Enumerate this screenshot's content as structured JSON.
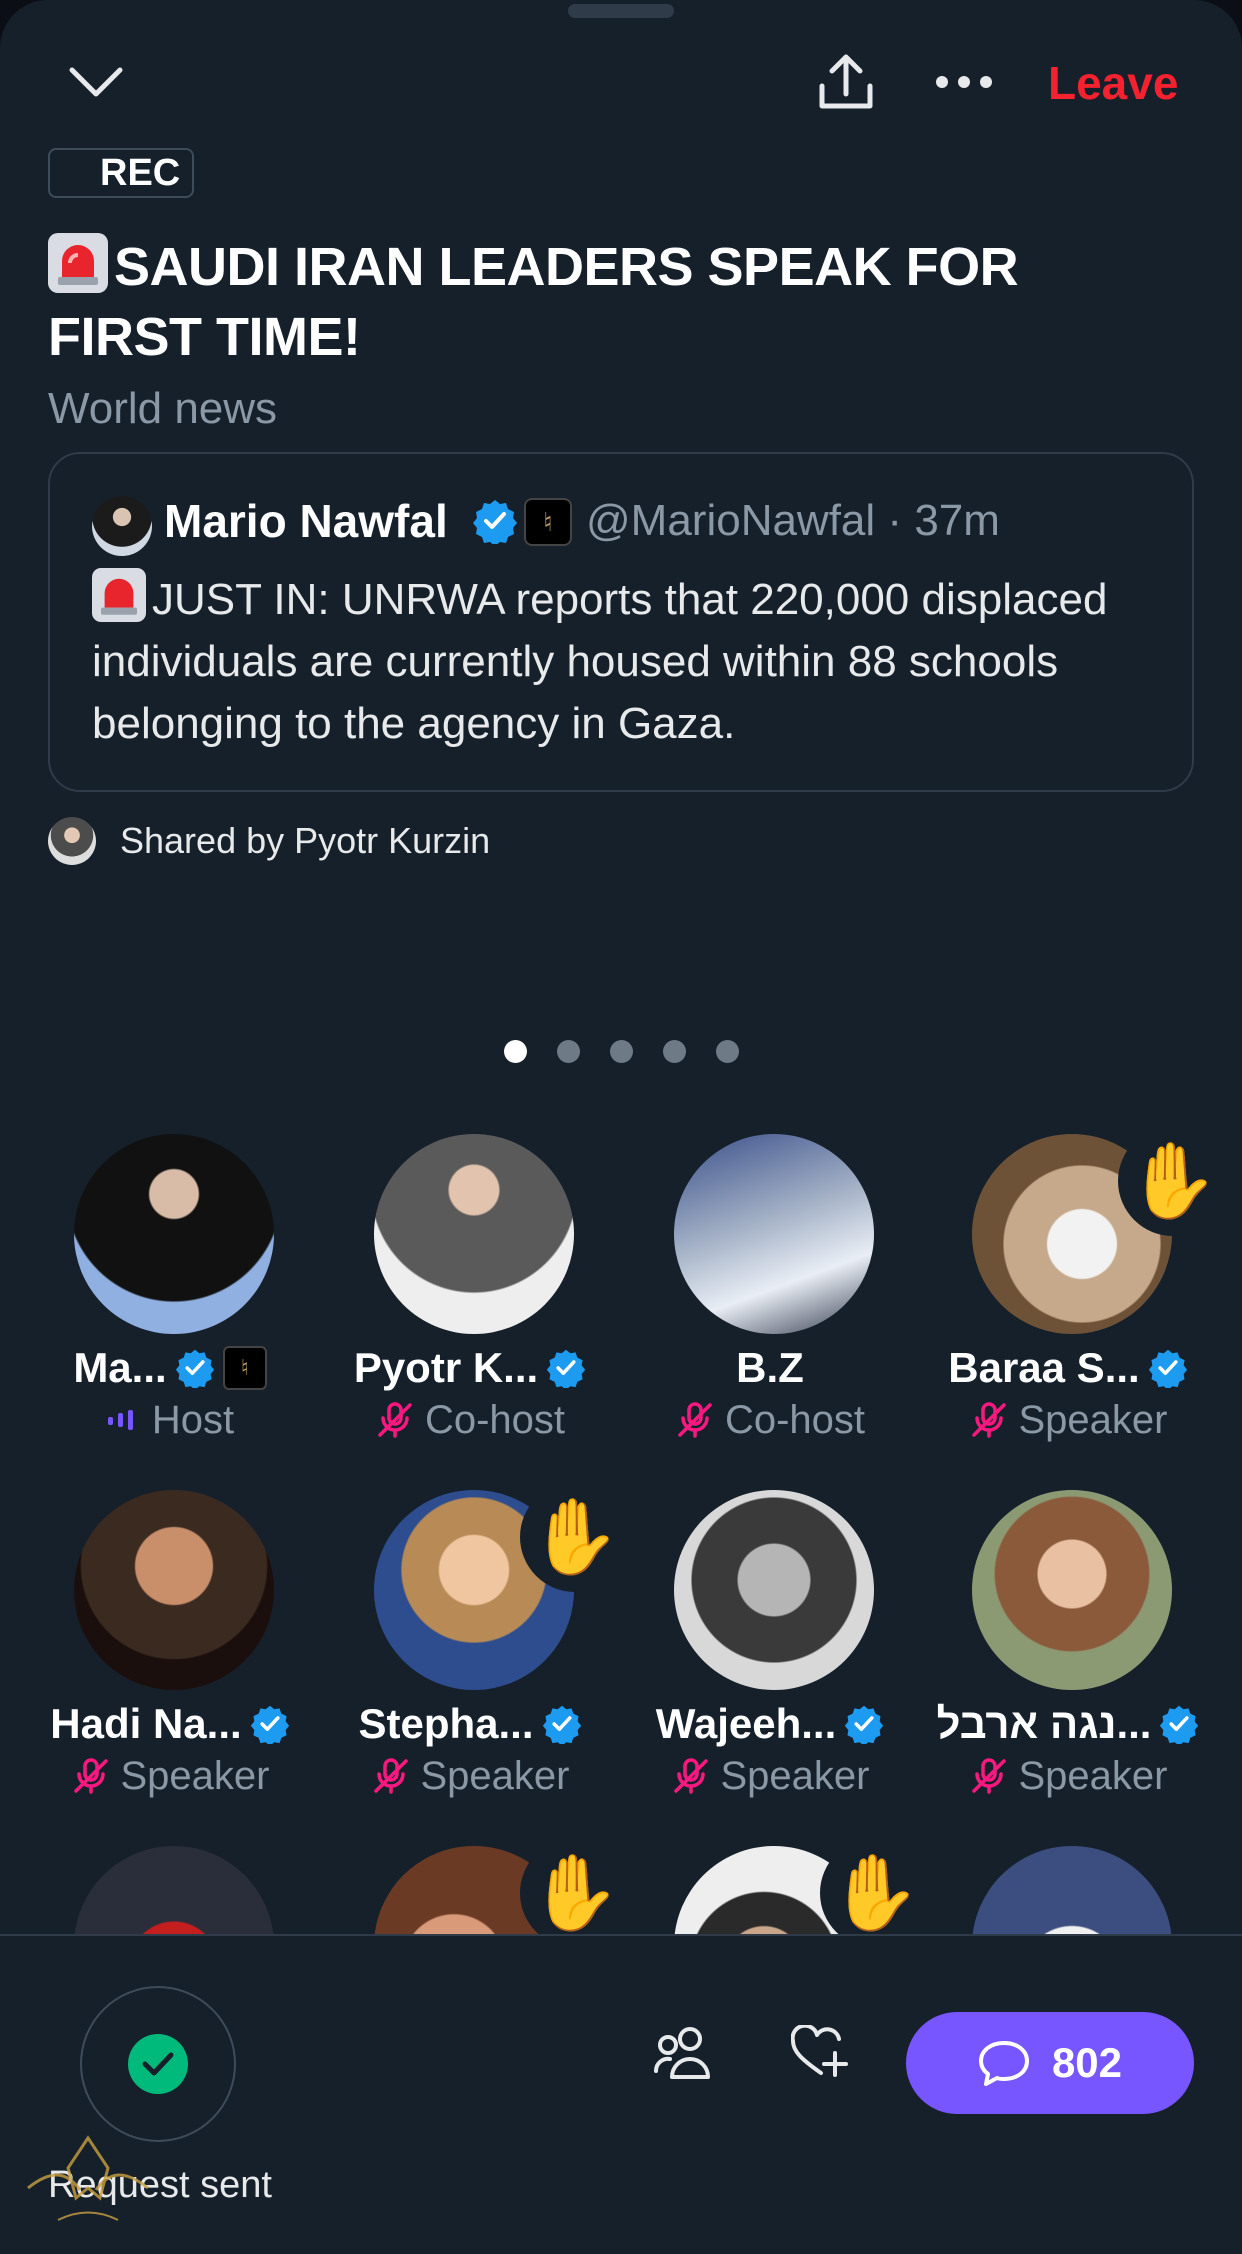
{
  "header": {
    "leave_label": "Leave",
    "rec_label": "REC",
    "title": "SAUDI IRAN LEADERS SPEAK FOR FIRST TIME!",
    "topic": "World news"
  },
  "pinned_tweet": {
    "author_name": "Mario Nawfal",
    "handle": "@MarioNawfal",
    "separator": "·",
    "age": "37m",
    "text": "JUST IN: UNRWA reports that 220,000 displaced individuals are currently housed within 88 schools belonging to the agency in Gaza."
  },
  "shared_by": "Shared by Pyotr Kurzin",
  "carousel": {
    "page_count": 5,
    "active_index": 0
  },
  "participants": [
    {
      "name": "Ma...",
      "role": "Host",
      "verified": true,
      "affiliate": true,
      "hand": false,
      "muted": false
    },
    {
      "name": "Pyotr K...",
      "role": "Co-host",
      "verified": true,
      "affiliate": false,
      "hand": false,
      "muted": true
    },
    {
      "name": "B.Z",
      "role": "Co-host",
      "verified": false,
      "affiliate": false,
      "hand": false,
      "muted": true
    },
    {
      "name": "Baraa S...",
      "role": "Speaker",
      "verified": true,
      "affiliate": false,
      "hand": true,
      "muted": true
    },
    {
      "name": "Hadi Na...",
      "role": "Speaker",
      "verified": true,
      "affiliate": false,
      "hand": false,
      "muted": true
    },
    {
      "name": "Stepha...",
      "role": "Speaker",
      "verified": true,
      "affiliate": false,
      "hand": true,
      "muted": true
    },
    {
      "name": "Wajeeh...",
      "role": "Speaker",
      "verified": true,
      "affiliate": false,
      "hand": false,
      "muted": true
    },
    {
      "name": "נגה ארבל...",
      "role": "Speaker",
      "verified": true,
      "affiliate": false,
      "hand": false,
      "muted": true
    },
    {
      "name": "",
      "role": "",
      "verified": false,
      "affiliate": false,
      "hand": false,
      "muted": false
    },
    {
      "name": "",
      "role": "",
      "verified": false,
      "affiliate": false,
      "hand": true,
      "muted": false
    },
    {
      "name": "",
      "role": "",
      "verified": false,
      "affiliate": false,
      "hand": true,
      "muted": false
    },
    {
      "name": "",
      "role": "",
      "verified": false,
      "affiliate": false,
      "hand": false,
      "muted": false
    }
  ],
  "footer": {
    "request_label": "Request sent",
    "comment_count": "802"
  },
  "colors": {
    "background": "#15202b",
    "leave": "#f4212e",
    "verified": "#1d9bf0",
    "muted_mic": "#f91880",
    "accent": "#7856ff",
    "success": "#00ba7c"
  },
  "icons": [
    "chevron-down-icon",
    "share-icon",
    "more-icon",
    "siren-icon",
    "verified-icon",
    "mic-off-icon",
    "audio-bars-icon",
    "raised-hand-icon",
    "check-icon",
    "people-icon",
    "heart-plus-icon",
    "comment-icon"
  ]
}
